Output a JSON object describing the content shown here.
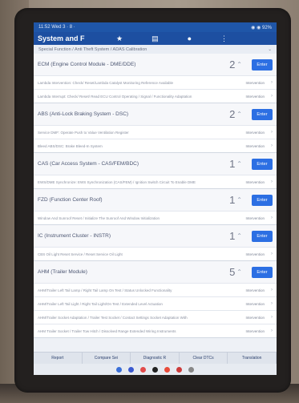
{
  "status": {
    "time": "11:52 Wed 3 · 8 ·",
    "right": "◉ ◉ 92%"
  },
  "app": {
    "title": "System and F",
    "back_icon": "menu-icon",
    "icons": [
      "star-icon",
      "list-icon",
      "person-icon",
      "more-icon"
    ]
  },
  "subtitle": {
    "text": "Special Function / Anti Theft System / ADAS Calibration",
    "caret": "⌄"
  },
  "modules": [
    {
      "name": "ECM (Engine Control Module - DME/DDE)",
      "count": "2",
      "enter": "Enter",
      "functions": [
        {
          "name": "Lambda Intervention: Check/ Reset/Lambda Catalyst Monitoring Reference Available",
          "status": "Intervention"
        },
        {
          "name": "Lambda Interrupt: Check/ Reset/ Read ECU Control Operating / Signal / Functionality Adaptation",
          "status": "Intervention"
        }
      ]
    },
    {
      "name": "ABS (Anti-Lock Braking System - DSC)",
      "count": "2",
      "enter": "Enter",
      "functions": [
        {
          "name": "Service DMF: Operate Push to Value Ventilation Register",
          "status": "Intervention"
        },
        {
          "name": "Bleed ABS/DSC: Brake Bleed-In System",
          "status": "Intervention"
        }
      ]
    },
    {
      "name": "CAS (Car Access System - CAS/FEM/BDC)",
      "count": "1",
      "enter": "Enter",
      "functions": [
        {
          "name": "EWS/DME Synchronize: EWS Synchronization (CAS/FEM) / Ignition Switch Circuit To Enable DME",
          "status": "Intervention"
        }
      ]
    },
    {
      "name": "FZD (Function Center Roof)",
      "count": "1",
      "enter": "Enter",
      "functions": [
        {
          "name": "Window And Sunroof Reset / Initialize The Sunroof And Window Initialization",
          "status": "Intervention"
        }
      ]
    },
    {
      "name": "IC (Instrument Cluster - INSTR)",
      "count": "1",
      "enter": "Enter",
      "functions": [
        {
          "name": "CBS Oil Light Reset Service / Reset Service Oil Light",
          "status": "Intervention"
        }
      ]
    },
    {
      "name": "AHM (Trailer Module)",
      "count": "5",
      "enter": "Enter",
      "functions": [
        {
          "name": "AHM/Trailer Left Tail Lamp / Right Tail Lamp On Test / Status Unlocked Functionality",
          "status": "Intervention"
        },
        {
          "name": "AHM/Trailer Left Tail Light / Right Tail Light/On Test / Extended Level Actuation",
          "status": "Intervention"
        },
        {
          "name": "AHM/Trailer Socket Adaptation / Trailer Test Socket / Contact Settings Socket Adaptation With",
          "status": "Intervention"
        },
        {
          "name": "AHM Trailer Socket / Trailer Tow Hitch / Dissolved Range Extended Wiring Instruments",
          "status": "Intervention"
        }
      ]
    }
  ],
  "bottom_tabs": [
    "Report",
    "Compare Sei",
    "Diagnostic R",
    "Clear DTCs",
    "Translation"
  ],
  "dock": {
    "colors": [
      "#3a6fd8",
      "#3a59d0",
      "#e24b4b",
      "#222222",
      "#e84b3a",
      "#cc3b3b",
      "#888888"
    ]
  }
}
